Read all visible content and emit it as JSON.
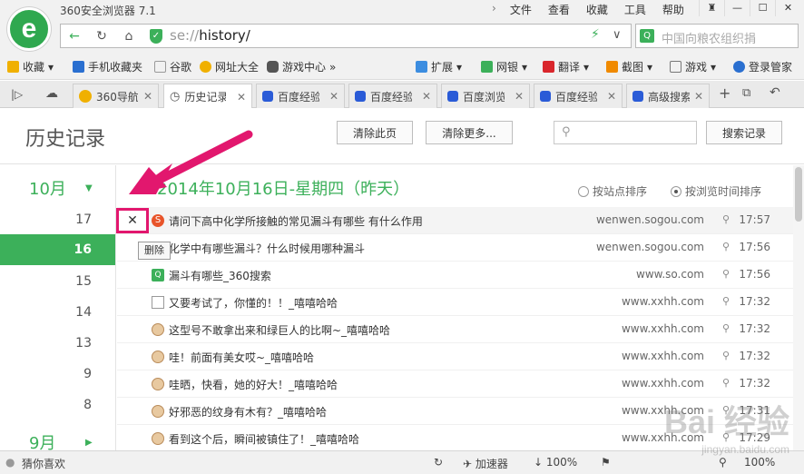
{
  "app": {
    "title": "360安全浏览器 7.1",
    "menu": [
      "文件",
      "查看",
      "收藏",
      "工具",
      "帮助"
    ]
  },
  "address": {
    "url_proto": "se://",
    "url_path": "history/",
    "search_placeholder": "中国向粮农组织捐"
  },
  "bookmarks": {
    "left": [
      "收藏",
      "手机收藏夹",
      "谷歌",
      "网址大全",
      "游戏中心"
    ],
    "right": [
      "扩展",
      "网银",
      "翻译",
      "截图",
      "游戏",
      "登录管家"
    ]
  },
  "tabs": [
    {
      "label": "360导航"
    },
    {
      "label": "历史记录"
    },
    {
      "label": "百度经验"
    },
    {
      "label": "百度经验"
    },
    {
      "label": "百度浏览"
    },
    {
      "label": "百度经验"
    },
    {
      "label": "高级搜索"
    }
  ],
  "page": {
    "title": "历史记录",
    "clear_page": "清除此页",
    "clear_more": "清除更多...",
    "search_btn": "搜索记录"
  },
  "sidebar": {
    "month_top": "10月",
    "month_bottom": "9月",
    "days": [
      "17",
      "16",
      "15",
      "14",
      "13",
      "9",
      "8"
    ]
  },
  "content": {
    "date_heading": "2014年10月16日-星期四（昨天）",
    "sort_by_site": "按站点排序",
    "sort_by_time": "按浏览时间排序",
    "delete_glyph": "✕",
    "delete_tooltip": "删除",
    "rows": [
      {
        "title": "请问下高中化学所接触的常见漏斗有哪些 有什么作用",
        "domain": "wenwen.sogou.com",
        "time": "17:57",
        "icon": "sogou"
      },
      {
        "title": "化学中有哪些漏斗？什么时候用哪种漏斗",
        "domain": "wenwen.sogou.com",
        "time": "17:56",
        "icon": "sogou"
      },
      {
        "title": "漏斗有哪些_360搜索",
        "domain": "www.so.com",
        "time": "17:56",
        "icon": "q"
      },
      {
        "title": "又要考试了，你懂的！！_嘻嘻哈哈",
        "domain": "www.xxhh.com",
        "time": "17:32",
        "icon": "doc"
      },
      {
        "title": "这型号不敢拿出来和绿巨人的比啊~_嘻嘻哈哈",
        "domain": "www.xxhh.com",
        "time": "17:32",
        "icon": "face"
      },
      {
        "title": "哇！前面有美女哎~_嘻嘻哈哈",
        "domain": "www.xxhh.com",
        "time": "17:32",
        "icon": "face"
      },
      {
        "title": "哇晒，快看，她的好大！_嘻嘻哈哈",
        "domain": "www.xxhh.com",
        "time": "17:32",
        "icon": "face"
      },
      {
        "title": "好邪恶的纹身有木有？_嘻嘻哈哈",
        "domain": "www.xxhh.com",
        "time": "17:31",
        "icon": "face"
      },
      {
        "title": "看到这个后，瞬间被镇住了！_嘻嘻哈哈",
        "domain": "www.xxhh.com",
        "time": "17:29",
        "icon": "face"
      }
    ]
  },
  "status": {
    "guess": "猜你喜欢",
    "accelerator": "加速器",
    "download_pct": "100%",
    "zoom": "100%"
  },
  "watermark": {
    "main": "Bai 经验",
    "sub": "jingyan.baidu.com"
  },
  "colors": {
    "accent": "#3cb05a",
    "annotation": "#e2176e"
  }
}
